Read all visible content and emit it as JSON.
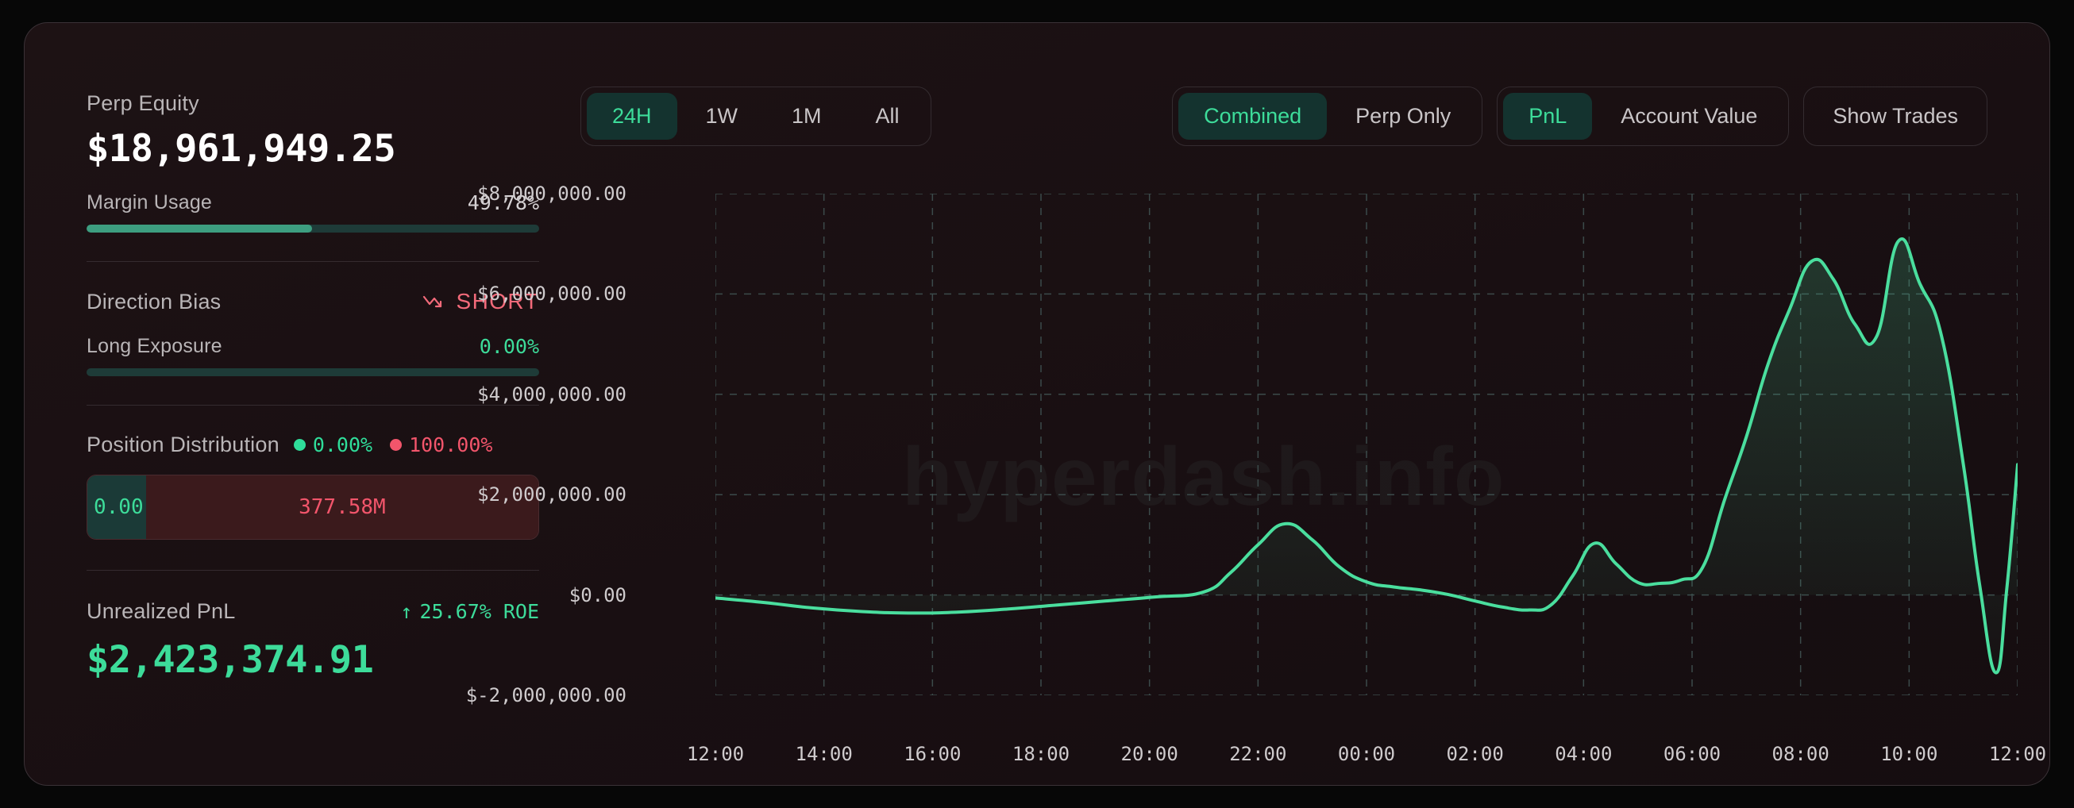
{
  "colors": {
    "accent_green": "#3ddc9a",
    "accent_red": "#f26a7a",
    "card_bg": "#1d1214",
    "page_bg": "#070707"
  },
  "sidebar": {
    "equity_label": "Perp Equity",
    "equity_value": "$18,961,949.25",
    "margin_label": "Margin Usage",
    "margin_value": "49.78%",
    "margin_pct": 49.78,
    "bias_label": "Direction Bias",
    "bias_value": "SHORT",
    "bias_icon": "trend-down-icon",
    "long_exposure_label": "Long Exposure",
    "long_exposure_value": "0.00%",
    "long_exposure_pct": 0,
    "position_label": "Position Distribution",
    "position_long_pct": "0.00%",
    "position_short_pct": "100.00%",
    "position_long_amount": "0.00",
    "position_short_amount": "377.58M",
    "pnl_label": "Unrealized PnL",
    "pnl_roe": "25.67% ROE",
    "pnl_roe_arrow": "↑",
    "pnl_value": "$2,423,374.91"
  },
  "toolbar": {
    "ranges": [
      {
        "label": "24H",
        "active": true
      },
      {
        "label": "1W",
        "active": false
      },
      {
        "label": "1M",
        "active": false
      },
      {
        "label": "All",
        "active": false
      }
    ],
    "modes": [
      {
        "label": "Combined",
        "active": true
      },
      {
        "label": "Perp Only",
        "active": false
      }
    ],
    "metrics": [
      {
        "label": "PnL",
        "active": true
      },
      {
        "label": "Account Value",
        "active": false
      }
    ],
    "show_trades_label": "Show Trades"
  },
  "chart_data": {
    "type": "area",
    "title": "",
    "xlabel": "",
    "ylabel": "",
    "watermark": "hyperdash.info",
    "grid": true,
    "legend": "none",
    "line_color": "#4ade9e",
    "fill_color": "rgba(77,222,158,0.10)",
    "ylim": [
      -2000000,
      8000000
    ],
    "yticks": [
      8000000,
      6000000,
      4000000,
      2000000,
      0,
      -2000000
    ],
    "ytick_labels": [
      "$8,000,000.00",
      "$6,000,000.00",
      "$4,000,000.00",
      "$2,000,000.00",
      "$0.00",
      "$-2,000,000.00"
    ],
    "xtick_labels": [
      "12:00",
      "14:00",
      "16:00",
      "18:00",
      "20:00",
      "22:00",
      "00:00",
      "02:00",
      "04:00",
      "06:00",
      "08:00",
      "10:00",
      "12:00"
    ],
    "x": [
      0.0,
      0.9,
      1.8,
      2.7,
      3.6,
      4.5,
      5.4,
      6.3,
      7.2,
      8.1,
      9.0,
      9.5,
      10.0,
      10.5,
      11.0,
      11.5,
      12.0,
      12.5,
      13.0,
      13.5,
      14.0,
      14.5,
      15.0,
      15.4,
      15.8,
      16.2,
      16.6,
      17.0,
      17.4,
      17.8,
      18.2,
      18.6,
      19.0,
      19.4,
      19.8,
      20.2,
      20.6,
      21.0,
      21.4,
      21.8,
      22.2,
      22.6,
      23.0,
      23.3,
      23.6,
      23.8,
      24.0
    ],
    "y": [
      -60000,
      -150000,
      -260000,
      -330000,
      -360000,
      -340000,
      -280000,
      -200000,
      -120000,
      -40000,
      60000,
      450000,
      1000000,
      1420000,
      1100000,
      560000,
      260000,
      160000,
      100000,
      10000,
      -120000,
      -240000,
      -300000,
      -200000,
      380000,
      1030000,
      620000,
      250000,
      230000,
      300000,
      560000,
      1900000,
      3150000,
      4600000,
      5700000,
      6650000,
      6300000,
      5400000,
      5150000,
      7050000,
      6200000,
      5150000,
      2600000,
      200000,
      -1550000,
      120000,
      2600000
    ]
  }
}
